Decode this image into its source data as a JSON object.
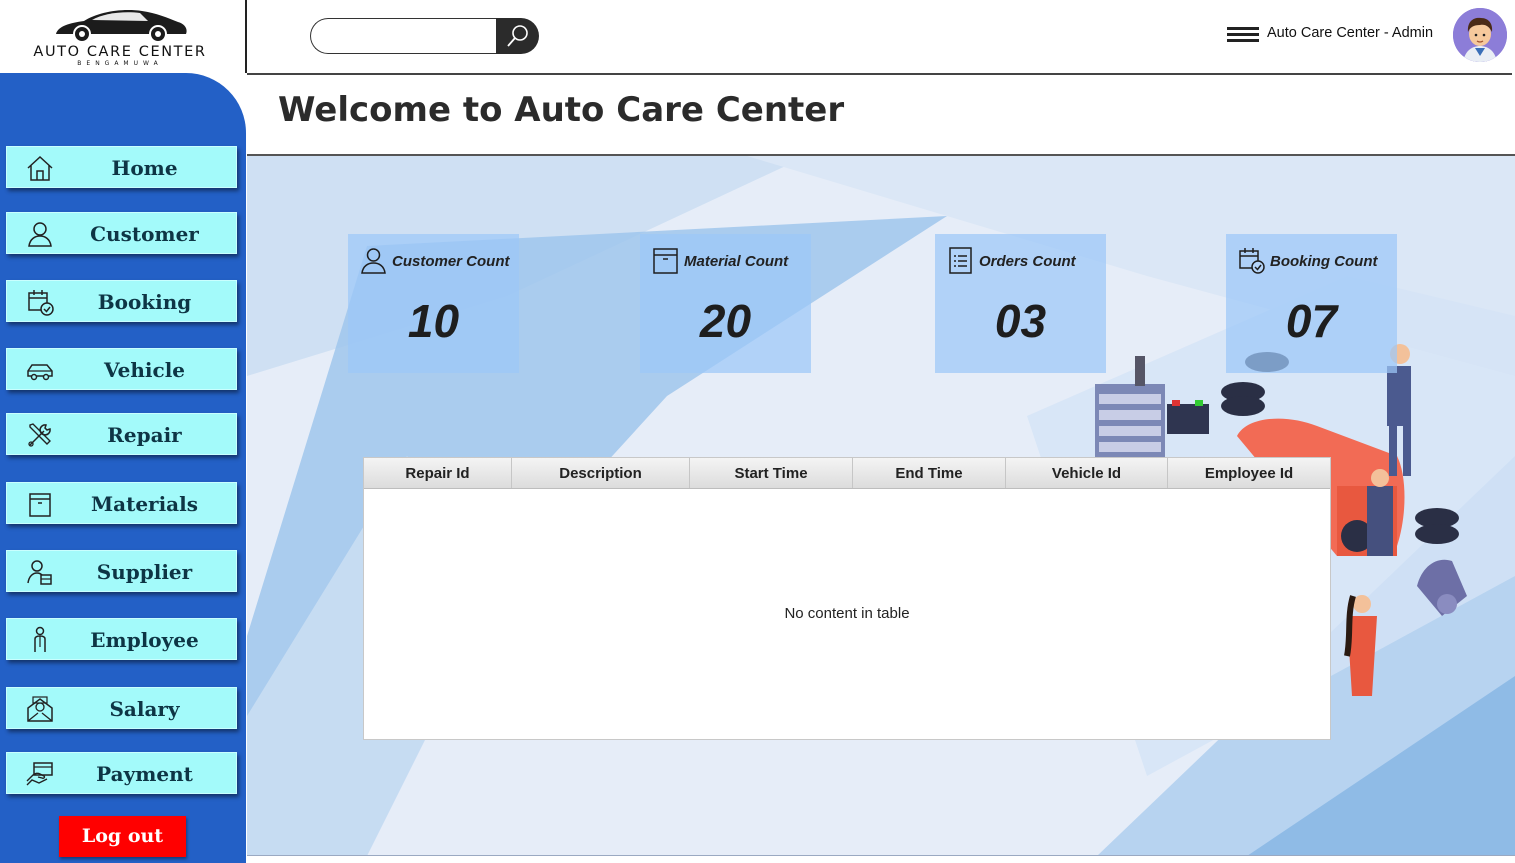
{
  "header": {
    "logo_text": "AUTO CARE CENTER",
    "logo_subtext": "BENGAMUWA",
    "search_placeholder": "",
    "user_label": "Auto Care Center - Admin"
  },
  "sidebar": {
    "items": [
      {
        "label": "Home",
        "icon": "home-icon"
      },
      {
        "label": "Customer",
        "icon": "user-icon"
      },
      {
        "label": "Booking",
        "icon": "calendar-check-icon"
      },
      {
        "label": "Vehicle",
        "icon": "car-icon"
      },
      {
        "label": "Repair",
        "icon": "tools-icon"
      },
      {
        "label": "Materials",
        "icon": "box-icon"
      },
      {
        "label": "Supplier",
        "icon": "supplier-icon"
      },
      {
        "label": "Employee",
        "icon": "employee-icon"
      },
      {
        "label": "Salary",
        "icon": "salary-icon"
      },
      {
        "label": "Payment",
        "icon": "payment-icon"
      }
    ],
    "logout_label": "Log out",
    "colors": {
      "background": "#2360c6",
      "button": "#a3fafa",
      "logout": "#ff0000"
    }
  },
  "main": {
    "title": "Welcome to Auto Care Center",
    "cards": [
      {
        "label": "Customer Count",
        "value": "10",
        "icon": "user-icon"
      },
      {
        "label": "Material Count",
        "value": "20",
        "icon": "box-icon"
      },
      {
        "label": "Orders Count",
        "value": "03",
        "icon": "list-icon"
      },
      {
        "label": "Booking Count",
        "value": "07",
        "icon": "calendar-check-icon"
      }
    ],
    "table": {
      "columns": [
        "Repair Id",
        "Description",
        "Start Time",
        "End Time",
        "Vehicle Id",
        "Employee Id"
      ],
      "rows": [],
      "empty_message": "No content in table"
    }
  }
}
